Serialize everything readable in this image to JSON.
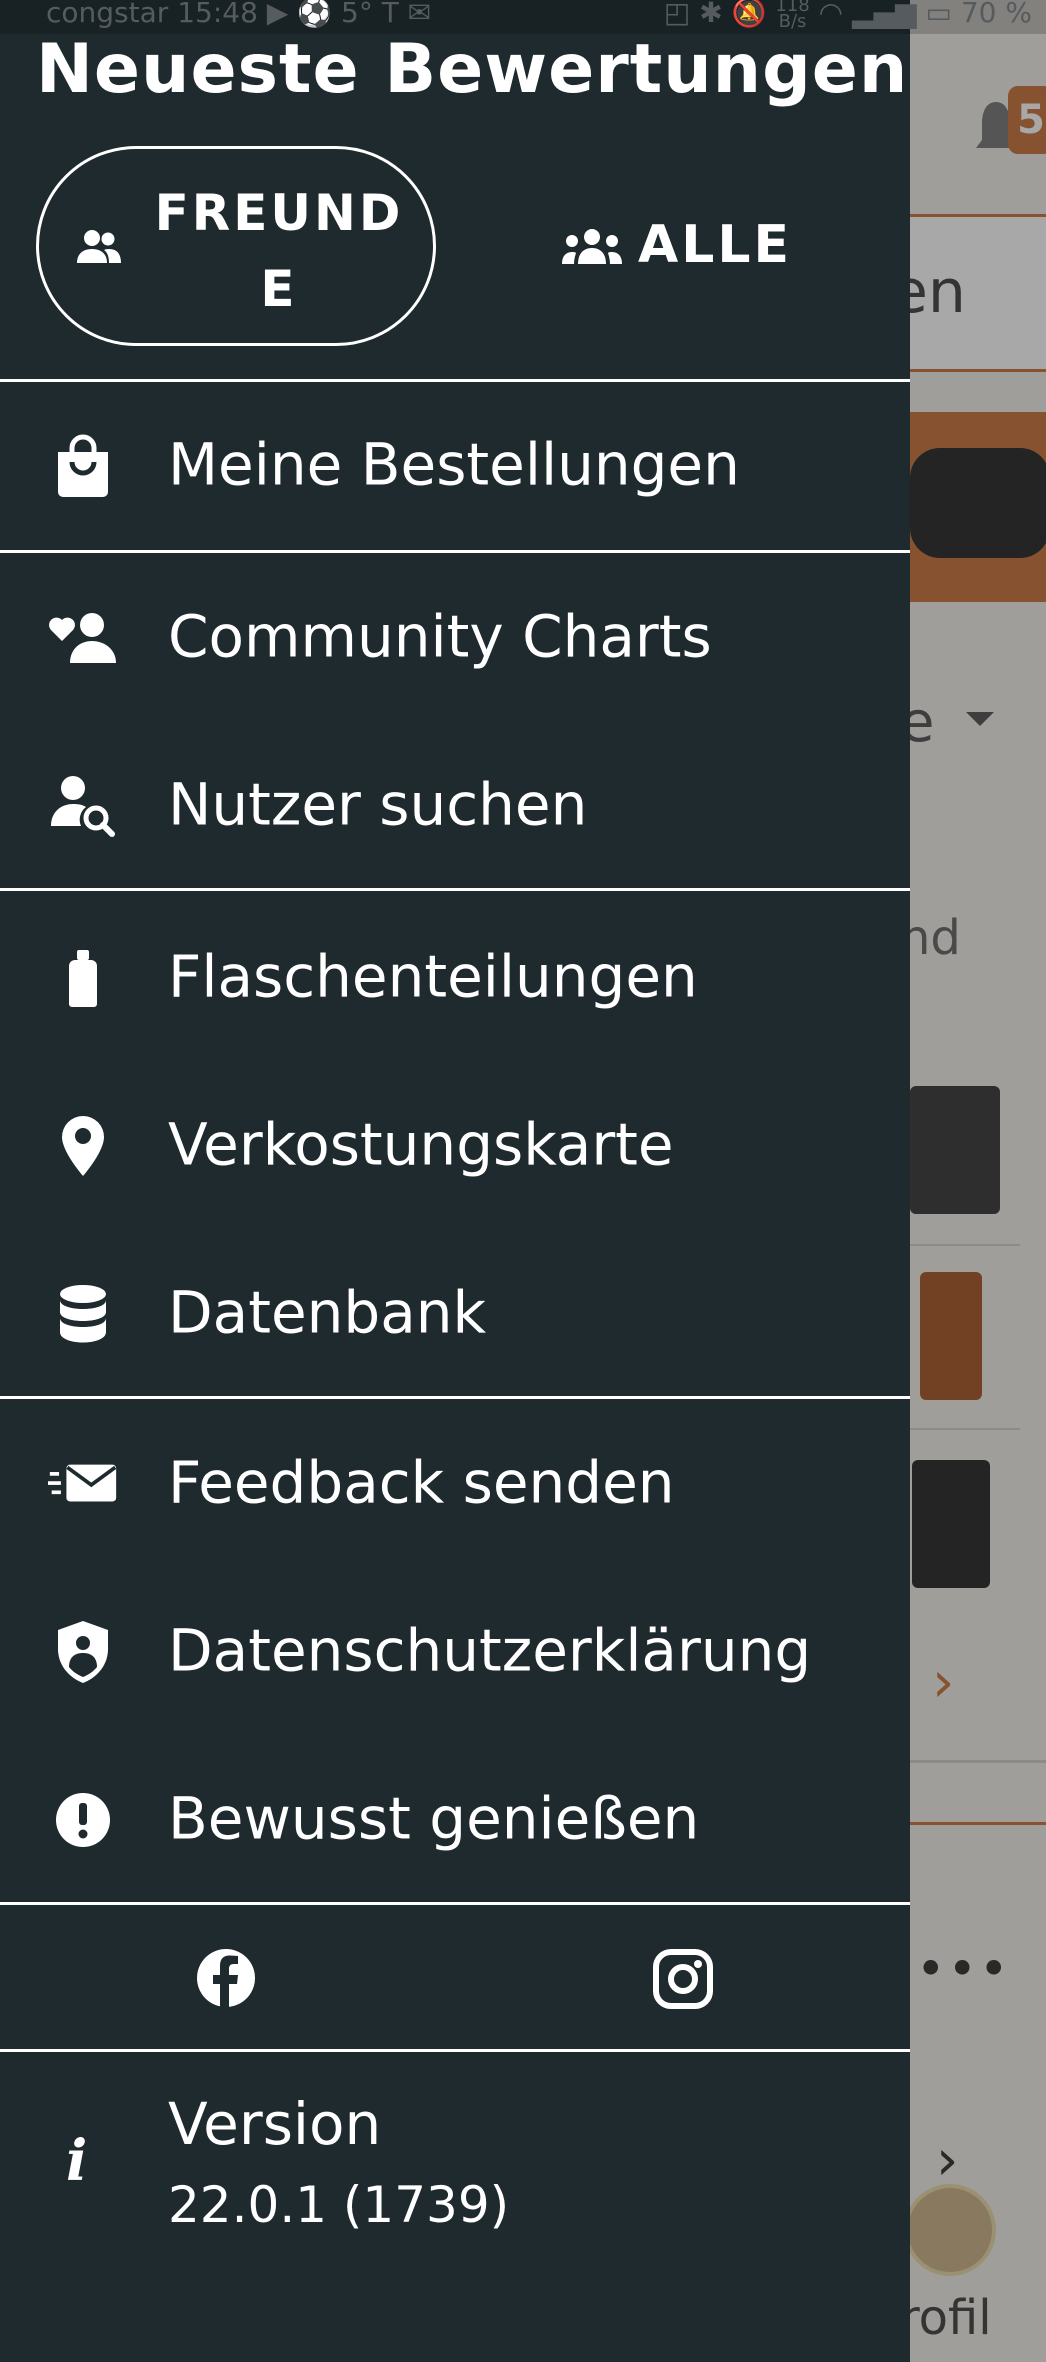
{
  "status_bar": {
    "carrier": "congstar",
    "time": "15:48",
    "temperature": "5°",
    "network_speed_value": "118",
    "network_speed_unit": "B/s",
    "battery": "70 %"
  },
  "background": {
    "notification_count": "5",
    "search_partial": "en",
    "sort_partial": "e",
    "list_partial": "nd",
    "bottom_nav_partial": "rofil"
  },
  "drawer": {
    "title": "Neueste Bewertungen",
    "toggle": {
      "friends_label": "FREUNDE",
      "all_label": "ALLE"
    },
    "menu_groups": [
      [
        {
          "label": "Meine Bestellungen",
          "icon": "shopping-bag-icon"
        }
      ],
      [
        {
          "label": "Community Charts",
          "icon": "community-heart-icon"
        },
        {
          "label": "Nutzer suchen",
          "icon": "user-search-icon"
        }
      ],
      [
        {
          "label": "Flaschenteilungen",
          "icon": "bottle-icon"
        },
        {
          "label": "Verkostungskarte",
          "icon": "map-pin-icon"
        },
        {
          "label": "Datenbank",
          "icon": "database-icon"
        }
      ],
      [
        {
          "label": "Feedback senden",
          "icon": "send-mail-icon"
        },
        {
          "label": "Datenschutzerklärung",
          "icon": "shield-user-icon"
        },
        {
          "label": "Bewusst genießen",
          "icon": "exclamation-circle-icon"
        }
      ]
    ],
    "social": {
      "facebook_icon": "facebook-icon",
      "instagram_icon": "instagram-icon"
    },
    "version": {
      "label": "Version",
      "number": "22.0.1 (1739)"
    }
  },
  "colors": {
    "drawer_bg": "#1e2a2e",
    "text": "#ffffff",
    "accent": "#c8753e"
  }
}
